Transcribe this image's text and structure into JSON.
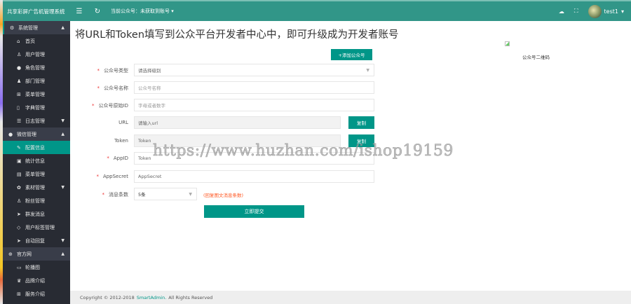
{
  "header": {
    "brand": "共享彩屏广告机管理系统",
    "current_account": "当前公众号：未获取到账号",
    "user": "test1"
  },
  "sidebar": {
    "groups": [
      {
        "label": "系统管理",
        "items": [
          "首页",
          "用户管理",
          "角色管理",
          "部门管理",
          "菜单管理",
          "字典管理",
          "日志管理"
        ]
      },
      {
        "label": "微信管理",
        "items": [
          "配置信息",
          "统计信息",
          "菜单管理",
          "素材管理",
          "粉丝管理",
          "群发消息",
          "用户标签管理",
          "自动回复"
        ]
      },
      {
        "label": "官方网",
        "items": [
          "轮播图",
          "品牌介绍",
          "服务介绍"
        ]
      }
    ]
  },
  "main": {
    "title": "将URL和Token填写到公众平台开发者中心中，即可升级成为开发者账号",
    "add_button": "+添加公众号",
    "qr_caption": "公众号二维码",
    "form": {
      "type": {
        "label": "公众号类型",
        "value": "请选择级别"
      },
      "name": {
        "label": "公众号名称",
        "placeholder": "公众号名称"
      },
      "origid": {
        "label": "公众号原始ID",
        "placeholder": "字母或者数字"
      },
      "url": {
        "label": "URL",
        "placeholder": "请输入url",
        "copy": "复制"
      },
      "token": {
        "label": "Token",
        "value": "Token",
        "copy": "复制"
      },
      "appid": {
        "label": "AppID",
        "value": "Token"
      },
      "appsecret": {
        "label": "AppSecret",
        "placeholder": "AppSecret"
      },
      "msgcount": {
        "label": "消息条数",
        "value": "5条",
        "hint": "(回复图文消息条数)"
      },
      "submit": "立即提交"
    }
  },
  "footer": {
    "prefix": "Copyright © 2012-2018",
    "link": "SmartAdmin.",
    "suffix": "All Rights Reserved"
  },
  "watermark": "https://www.huzhan.com/ishop19159",
  "colors": {
    "accent": "#009688",
    "topbar": "#319688",
    "sidebar": "#282b33"
  }
}
